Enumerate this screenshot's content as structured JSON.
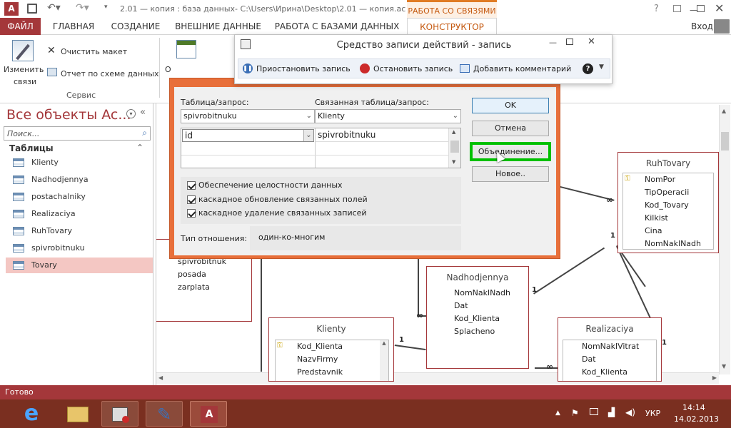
{
  "window": {
    "title": "2.01 — копия : база данных- C:\\Users\\Ирина\\Desktop\\2.01 — копия.ас...",
    "context_tab": "РАБОТА СО СВЯЗЯМИ",
    "help": "?",
    "login": "Вход"
  },
  "ribbon_tabs": [
    "ФАЙЛ",
    "ГЛАВНАЯ",
    "СОЗДАНИЕ",
    "ВНЕШНИЕ ДАННЫЕ",
    "РАБОТА С БАЗАМИ ДАННЫХ",
    "КОНСТРУКТОР"
  ],
  "ribbon": {
    "edit_label": "Изменить",
    "edit_label2": "связи",
    "clear_layout": "Очистить макет",
    "report": "Отчет по схеме данных",
    "group": "Сервис",
    "partial": "О"
  },
  "nav": {
    "title": "Все объекты Ac...",
    "search_placeholder": "Поиск...",
    "section": "Таблицы",
    "items": [
      "Klienty",
      "Nadhodjennya",
      "postachalniky",
      "Realizaciya",
      "RuhTovary",
      "spivrobitnuku",
      "Tovary"
    ]
  },
  "recorder": {
    "title": "Средство записи действий - запись",
    "pause": "Приостановить запись",
    "stop": "Остановить запись",
    "comment": "Добавить комментарий"
  },
  "dialog": {
    "table_label": "Таблица/запрос:",
    "related_label": "Связанная таблица/запрос:",
    "table_value": "spivrobitnuku",
    "related_value": "Klienty",
    "field_left": "id",
    "field_right": "spivrobitnuku",
    "integrity": "Обеспечение целостности данных",
    "cascade_update": "каскадное обновление связанных полей",
    "cascade_delete": "каскадное удаление связанных записей",
    "rel_type_label": "Тип отношения:",
    "rel_type_value": "один-ко-многим",
    "ok": "OK",
    "cancel": "Отмена",
    "join": "Объединение...",
    "new": "Новое.."
  },
  "tables": {
    "ruhtovary": {
      "name": "RuhTovary",
      "fields": [
        "NomPor",
        "TipOperacii",
        "Kod_Tovary",
        "Kilkist",
        "Cina",
        "NomNaklNadh"
      ]
    },
    "nadhodjennya": {
      "name": "Nadhodjennya",
      "fields": [
        "NomNaklNadh",
        "Dat",
        "Kod_Klienta",
        "Splacheno"
      ]
    },
    "klienty": {
      "name": "Klienty",
      "fields": [
        "Kod_Klienta",
        "NazvFirmy",
        "Predstavnik"
      ]
    },
    "realizaciya": {
      "name": "Realizaciya",
      "fields": [
        "NomNaklVitrat",
        "Dat",
        "Kod_Klienta"
      ]
    },
    "spivr": {
      "fields": [
        "spivrobitnuk",
        "posada",
        "zarplata"
      ]
    }
  },
  "rel_labels": {
    "one": "1",
    "many": "∞"
  },
  "status": "Готово",
  "tray": {
    "lang": "УКР",
    "time": "14:14",
    "date": "14.02.2013"
  },
  "colors": {
    "accent": "#a4373a",
    "highlight": "#00c000",
    "context": "#e07b24"
  }
}
